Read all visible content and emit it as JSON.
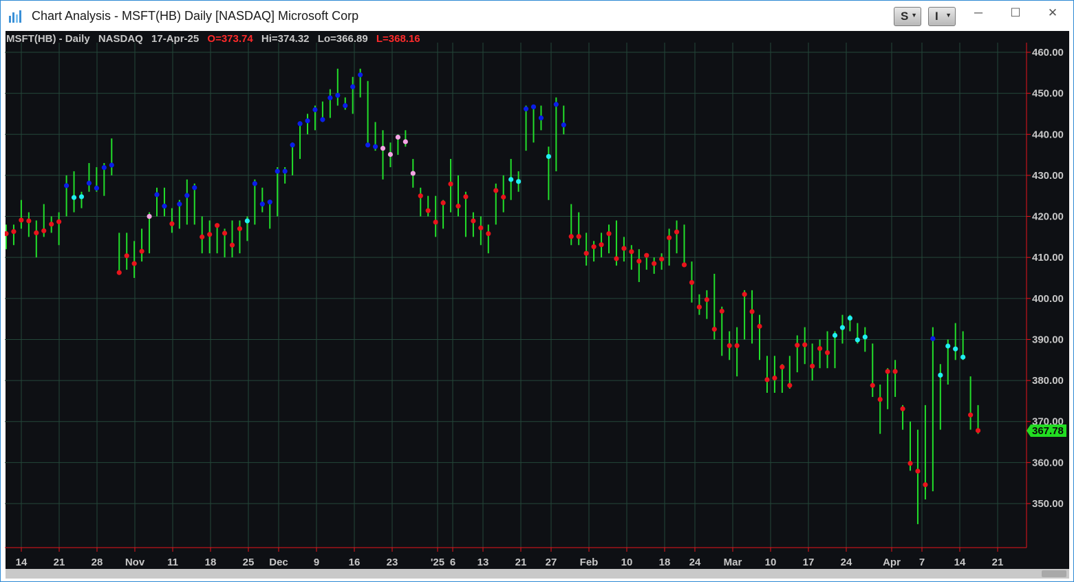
{
  "window": {
    "title": "Chart Analysis - MSFT(HB) Daily [NASDAQ] Microsoft Corp",
    "buttons": {
      "s_label": "S",
      "i_label": "I",
      "minimize": "─",
      "maximize": "☐",
      "close": "✕"
    },
    "icon": "chart-app-icon"
  },
  "header": {
    "symbol": "MSFT(HB) - Daily",
    "exchange": "NASDAQ",
    "date": "17-Apr-25",
    "open": "O=373.74",
    "high": "Hi=374.32",
    "low": "Lo=366.89",
    "last": "L=368.16"
  },
  "price_tag": "367.78",
  "colors": {
    "background": "#0e1014",
    "grid": "#24473a",
    "bar": "#22e02a",
    "red_dot": "#e8141c",
    "blue_dot": "#0a1ee8",
    "cyan_dot": "#20eef0",
    "pink_dot": "#f4a4e4",
    "axis_text": "#c8c8c8",
    "price_tag_bg": "#22dd22"
  },
  "chart_data": {
    "type": "bar",
    "ylim": [
      340,
      462
    ],
    "y_ticks": [
      "460.00",
      "450.00",
      "440.00",
      "430.00",
      "420.00",
      "410.00",
      "400.00",
      "390.00",
      "380.00",
      "370.00",
      "360.00",
      "350.00"
    ],
    "x_ticks": [
      "14",
      "21",
      "28",
      "Nov",
      "11",
      "18",
      "25",
      "Dec",
      "9",
      "16",
      "23",
      "'25",
      "6",
      "13",
      "21",
      "27",
      "Feb",
      "10",
      "18",
      "24",
      "Mar",
      "10",
      "17",
      "24",
      "Apr",
      "7",
      "14",
      "21"
    ],
    "series": [
      {
        "values": [
          {
            "h": 418,
            "l": 412,
            "c": 415.8,
            "d": "r"
          },
          {
            "h": 418,
            "l": 413,
            "c": 416.3,
            "d": "r"
          },
          {
            "h": 424,
            "l": 417,
            "c": 419.1,
            "d": "r"
          },
          {
            "h": 421,
            "l": 415,
            "c": 418.9,
            "d": "r"
          },
          {
            "h": 419,
            "l": 410,
            "c": 416.0,
            "d": "r"
          },
          {
            "h": 423,
            "l": 415,
            "c": 416.5,
            "d": "r"
          },
          {
            "h": 420,
            "l": 416,
            "c": 418.1,
            "d": "r"
          },
          {
            "h": 421,
            "l": 413,
            "c": 418.7,
            "d": "r"
          },
          {
            "h": 430,
            "l": 420,
            "c": 427.5,
            "d": "b"
          },
          {
            "h": 431,
            "l": 421,
            "c": 424.6,
            "d": "c"
          },
          {
            "h": 426,
            "l": 422,
            "c": 424.8,
            "d": "c"
          },
          {
            "h": 433,
            "l": 426,
            "c": 428.1,
            "d": "b"
          },
          {
            "h": 432,
            "l": 426,
            "c": 426.9,
            "d": "b"
          },
          {
            "h": 433,
            "l": 425,
            "c": 431.9,
            "d": "b"
          },
          {
            "h": 439,
            "l": 430,
            "c": 432.5,
            "d": "b"
          },
          {
            "h": 416,
            "l": 406,
            "c": 406.3,
            "d": "r"
          },
          {
            "h": 416,
            "l": 407,
            "c": 410.4,
            "d": "r"
          },
          {
            "h": 414,
            "l": 405,
            "c": 408.5,
            "d": "r"
          },
          {
            "h": 417,
            "l": 409,
            "c": 411.5,
            "d": "r"
          },
          {
            "h": 421,
            "l": 411,
            "c": 420.0,
            "d": "p"
          },
          {
            "h": 427,
            "l": 420,
            "c": 425.3,
            "d": "b"
          },
          {
            "h": 427,
            "l": 420,
            "c": 422.5,
            "d": "b"
          },
          {
            "h": 422,
            "l": 416,
            "c": 418.2,
            "d": "r"
          },
          {
            "h": 424,
            "l": 417,
            "c": 423.0,
            "d": "b"
          },
          {
            "h": 429,
            "l": 418,
            "c": 425.1,
            "d": "b"
          },
          {
            "h": 428,
            "l": 418,
            "c": 427.0,
            "d": "b"
          },
          {
            "h": 420,
            "l": 411,
            "c": 415.0,
            "d": "r"
          },
          {
            "h": 419,
            "l": 411,
            "c": 415.6,
            "d": "r"
          },
          {
            "h": 418,
            "l": 411,
            "c": 417.8,
            "d": "r"
          },
          {
            "h": 417,
            "l": 410,
            "c": 415.9,
            "d": "r"
          },
          {
            "h": 419,
            "l": 410,
            "c": 413.0,
            "d": "r"
          },
          {
            "h": 419,
            "l": 411,
            "c": 417.0,
            "d": "r"
          },
          {
            "h": 420,
            "l": 414,
            "c": 418.9,
            "d": "c"
          },
          {
            "h": 429,
            "l": 418,
            "c": 428.0,
            "d": "b"
          },
          {
            "h": 427,
            "l": 421,
            "c": 423.0,
            "d": "b"
          },
          {
            "h": 424,
            "l": 417,
            "c": 423.5,
            "d": "b"
          },
          {
            "h": 432,
            "l": 420,
            "c": 431.0,
            "d": "b"
          },
          {
            "h": 432,
            "l": 428,
            "c": 431.0,
            "d": "b"
          },
          {
            "h": 438,
            "l": 430,
            "c": 437.4,
            "d": "b"
          },
          {
            "h": 443,
            "l": 434,
            "c": 442.6,
            "d": "b"
          },
          {
            "h": 445,
            "l": 440,
            "c": 443.3,
            "d": "b"
          },
          {
            "h": 447,
            "l": 441,
            "c": 446.0,
            "d": "b"
          },
          {
            "h": 448,
            "l": 443,
            "c": 443.6,
            "d": "b"
          },
          {
            "h": 451,
            "l": 444,
            "c": 448.9,
            "d": "b"
          },
          {
            "h": 456,
            "l": 447,
            "c": 449.5,
            "d": "b"
          },
          {
            "h": 449,
            "l": 446,
            "c": 447.0,
            "d": "b"
          },
          {
            "h": 454,
            "l": 445,
            "c": 451.6,
            "d": "b"
          },
          {
            "h": 456,
            "l": 449,
            "c": 454.5,
            "d": "b"
          },
          {
            "h": 453,
            "l": 437,
            "c": 437.4,
            "d": "b"
          },
          {
            "h": 443,
            "l": 436,
            "c": 437.0,
            "d": "b"
          },
          {
            "h": 441,
            "l": 429,
            "c": 436.6,
            "d": "p"
          },
          {
            "h": 438,
            "l": 432,
            "c": 435.1,
            "d": "p"
          },
          {
            "h": 440,
            "l": 435,
            "c": 439.3,
            "d": "p"
          },
          {
            "h": 441,
            "l": 437,
            "c": 438.2,
            "d": "p"
          },
          {
            "h": 434,
            "l": 427,
            "c": 430.5,
            "d": "p"
          },
          {
            "h": 427,
            "l": 420,
            "c": 425.0,
            "d": "r"
          },
          {
            "h": 425,
            "l": 420,
            "c": 421.4,
            "d": "r"
          },
          {
            "h": 425,
            "l": 415,
            "c": 418.6,
            "d": "r"
          },
          {
            "h": 424,
            "l": 417,
            "c": 423.3,
            "d": "r"
          },
          {
            "h": 434,
            "l": 421,
            "c": 427.9,
            "d": "r"
          },
          {
            "h": 430,
            "l": 420,
            "c": 422.5,
            "d": "r"
          },
          {
            "h": 426,
            "l": 415,
            "c": 424.8,
            "d": "r"
          },
          {
            "h": 421,
            "l": 415,
            "c": 418.9,
            "d": "r"
          },
          {
            "h": 420,
            "l": 413,
            "c": 417.2,
            "d": "r"
          },
          {
            "h": 418,
            "l": 411,
            "c": 415.8,
            "d": "r"
          },
          {
            "h": 428,
            "l": 418,
            "c": 426.3,
            "d": "r"
          },
          {
            "h": 430,
            "l": 421,
            "c": 424.7,
            "d": "r"
          },
          {
            "h": 434,
            "l": 424,
            "c": 429.0,
            "d": "c"
          },
          {
            "h": 431,
            "l": 426,
            "c": 428.5,
            "d": "c"
          },
          {
            "h": 447,
            "l": 436,
            "c": 446.2,
            "d": "b"
          },
          {
            "h": 447,
            "l": 438,
            "c": 446.7,
            "d": "b"
          },
          {
            "h": 447,
            "l": 441,
            "c": 444.0,
            "d": "b"
          },
          {
            "h": 437,
            "l": 424,
            "c": 434.6,
            "d": "c"
          },
          {
            "h": 449,
            "l": 431,
            "c": 447.3,
            "d": "b"
          },
          {
            "h": 447,
            "l": 440,
            "c": 442.3,
            "d": "b"
          },
          {
            "h": 423,
            "l": 413,
            "c": 415.1,
            "d": "r"
          },
          {
            "h": 421,
            "l": 413,
            "c": 415.1,
            "d": "r"
          },
          {
            "h": 416,
            "l": 408,
            "c": 411.0,
            "d": "r"
          },
          {
            "h": 414,
            "l": 409,
            "c": 412.6,
            "d": "r"
          },
          {
            "h": 416,
            "l": 410,
            "c": 413.1,
            "d": "r"
          },
          {
            "h": 418,
            "l": 411,
            "c": 415.8,
            "d": "r"
          },
          {
            "h": 419,
            "l": 408,
            "c": 409.7,
            "d": "r"
          },
          {
            "h": 415,
            "l": 409,
            "c": 412.2,
            "d": "r"
          },
          {
            "h": 413,
            "l": 407,
            "c": 411.4,
            "d": "r"
          },
          {
            "h": 412,
            "l": 404,
            "c": 409.1,
            "d": "r"
          },
          {
            "h": 411,
            "l": 407,
            "c": 410.5,
            "d": "r"
          },
          {
            "h": 410,
            "l": 406,
            "c": 408.5,
            "d": "r"
          },
          {
            "h": 411,
            "l": 407,
            "c": 409.6,
            "d": "r"
          },
          {
            "h": 417,
            "l": 408,
            "c": 414.8,
            "d": "r"
          },
          {
            "h": 419,
            "l": 411,
            "c": 416.2,
            "d": "r"
          },
          {
            "h": 418,
            "l": 408,
            "c": 408.2,
            "d": "r"
          },
          {
            "h": 409,
            "l": 399,
            "c": 403.9,
            "d": "r"
          },
          {
            "h": 401,
            "l": 396,
            "c": 397.9,
            "d": "r"
          },
          {
            "h": 402,
            "l": 395,
            "c": 399.7,
            "d": "r"
          },
          {
            "h": 406,
            "l": 390,
            "c": 392.5,
            "d": "r"
          },
          {
            "h": 398,
            "l": 386,
            "c": 396.9,
            "d": "r"
          },
          {
            "h": 392,
            "l": 385,
            "c": 388.5,
            "d": "r"
          },
          {
            "h": 393,
            "l": 381,
            "c": 388.5,
            "d": "r"
          },
          {
            "h": 402,
            "l": 390,
            "c": 401.0,
            "d": "r"
          },
          {
            "h": 402,
            "l": 389,
            "c": 396.8,
            "d": "r"
          },
          {
            "h": 396,
            "l": 385,
            "c": 393.2,
            "d": "r"
          },
          {
            "h": 386,
            "l": 377,
            "c": 380.2,
            "d": "r"
          },
          {
            "h": 386,
            "l": 377,
            "c": 380.6,
            "d": "r"
          },
          {
            "h": 384,
            "l": 377,
            "c": 383.3,
            "d": "r"
          },
          {
            "h": 386,
            "l": 378,
            "c": 378.8,
            "d": "r"
          },
          {
            "h": 391,
            "l": 382,
            "c": 388.6,
            "d": "r"
          },
          {
            "h": 393,
            "l": 384,
            "c": 388.7,
            "d": "r"
          },
          {
            "h": 389,
            "l": 380,
            "c": 383.5,
            "d": "r"
          },
          {
            "h": 390,
            "l": 383,
            "c": 387.8,
            "d": "r"
          },
          {
            "h": 392,
            "l": 383,
            "c": 386.8,
            "d": "r"
          },
          {
            "h": 392,
            "l": 383,
            "c": 391.0,
            "d": "c"
          },
          {
            "h": 396,
            "l": 389,
            "c": 392.9,
            "d": "c"
          },
          {
            "h": 396,
            "l": 392,
            "c": 395.2,
            "d": "c"
          },
          {
            "h": 394,
            "l": 389,
            "c": 389.9,
            "d": "c"
          },
          {
            "h": 393,
            "l": 387,
            "c": 390.6,
            "d": "c"
          },
          {
            "h": 389,
            "l": 376,
            "c": 378.8,
            "d": "r"
          },
          {
            "h": 379,
            "l": 367,
            "c": 375.4,
            "d": "r"
          },
          {
            "h": 383,
            "l": 373,
            "c": 382.2,
            "d": "r"
          },
          {
            "h": 385,
            "l": 376,
            "c": 382.2,
            "d": "r"
          },
          {
            "h": 374,
            "l": 368,
            "c": 373.1,
            "d": "r"
          },
          {
            "h": 370,
            "l": 358,
            "c": 359.8,
            "d": "r"
          },
          {
            "h": 368,
            "l": 345,
            "c": 357.9,
            "d": "r"
          },
          {
            "h": 374,
            "l": 351,
            "c": 354.6,
            "d": "r"
          },
          {
            "h": 393,
            "l": 353,
            "c": 390.2,
            "d": "b"
          },
          {
            "h": 384,
            "l": 368,
            "c": 381.3,
            "d": "c"
          },
          {
            "h": 390,
            "l": 379,
            "c": 388.4,
            "d": "c"
          },
          {
            "h": 394,
            "l": 385,
            "c": 387.7,
            "d": "c"
          },
          {
            "h": 392,
            "l": 385,
            "c": 385.7,
            "d": "c"
          },
          {
            "h": 381,
            "l": 368,
            "c": 371.6,
            "d": "r"
          },
          {
            "h": 374,
            "l": 367,
            "c": 367.8,
            "d": "r"
          }
        ]
      }
    ]
  }
}
